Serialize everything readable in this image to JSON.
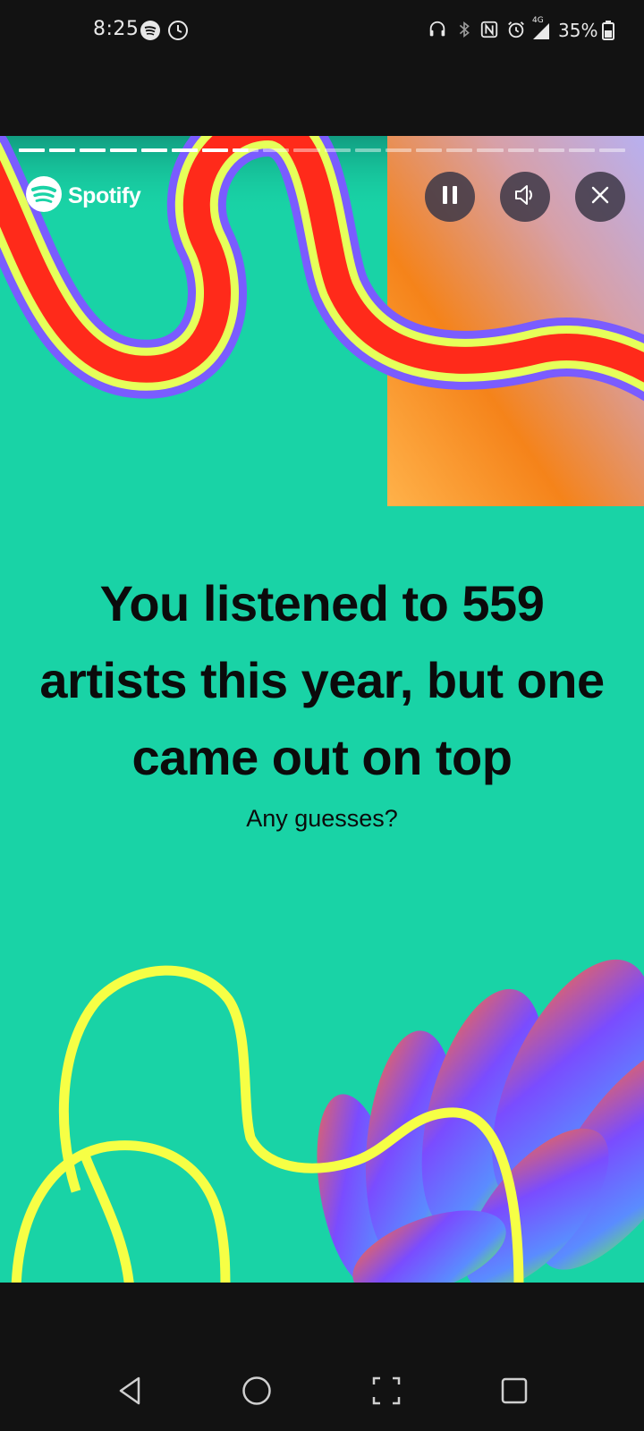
{
  "status_bar": {
    "time": "8:25",
    "battery_percent": "35%",
    "network_label": "4G",
    "icons": [
      "spotify-icon",
      "clock-icon",
      "headset-icon",
      "bluetooth-icon",
      "nfc-icon",
      "alarm-icon",
      "signal-icon",
      "battery-icon"
    ]
  },
  "story": {
    "progress_total_segments": 20,
    "progress_completed_segments": 7,
    "brand_label": "Spotify",
    "headline": "You listened to 559 artists this year, but one came out on top",
    "subtitle": "Any guesses?",
    "background_color": "#19d3a6",
    "accent_yellow": "#f6ff45"
  },
  "controls": {
    "pause_icon": "pause-icon",
    "sound_icon": "speaker-icon",
    "close_icon": "close-icon"
  },
  "nav_bar": {
    "icons": [
      "back-triangle-icon",
      "home-circle-icon",
      "screenshot-icon",
      "recents-square-icon"
    ]
  }
}
